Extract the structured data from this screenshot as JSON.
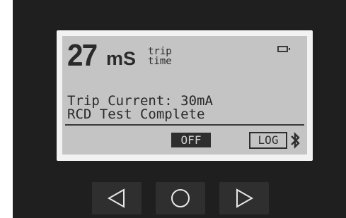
{
  "display": {
    "trip_time_value": "27",
    "trip_time_unit": "mS",
    "trip_time_label_1": "trip",
    "trip_time_label_2": "time",
    "trip_current": "Trip Current: 30mA",
    "status": "RCD Test Complete",
    "softkey_off": "OFF",
    "softkey_log": "LOG"
  },
  "icons": {
    "battery": "battery-icon",
    "bluetooth": "bluetooth-icon",
    "left": "triangle-left-icon",
    "center": "circle-icon",
    "right": "triangle-right-icon"
  },
  "colors": {
    "lcd_background": "#c4c4c4",
    "lcd_text": "#2a2a2a",
    "device_body": "#1f1f1f",
    "button_face": "#2f2f2f"
  }
}
